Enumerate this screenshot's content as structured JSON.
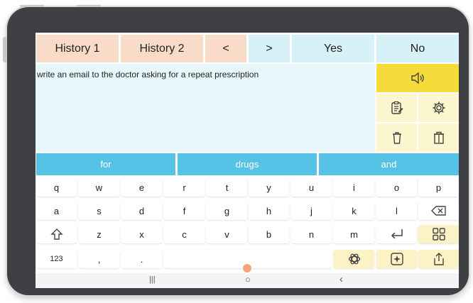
{
  "topbar": {
    "history1": "History 1",
    "history2": "History 2",
    "prev": "<",
    "next": ">",
    "yes": "Yes",
    "no": "No"
  },
  "message": {
    "text": "write an email to the doctor asking for a repeat prescription"
  },
  "suggestions": [
    "for",
    "drugs",
    "and"
  ],
  "keyboard": {
    "row1": [
      "q",
      "w",
      "e",
      "r",
      "t",
      "y",
      "u",
      "i",
      "o",
      "p"
    ],
    "row2": [
      "a",
      "s",
      "d",
      "f",
      "g",
      "h",
      "j",
      "k",
      "l"
    ],
    "row3": [
      "z",
      "x",
      "c",
      "v",
      "b",
      "n",
      "m"
    ],
    "numbers_key": "123",
    "comma_key": ",",
    "period_key": "."
  },
  "icons": {
    "speak": "speaker-icon",
    "notes": "clipboard-icon",
    "settings": "gear-icon",
    "delete_word": "trash-icon",
    "delete_all": "trash-lid-icon",
    "backspace": "backspace-icon",
    "shift": "shift-icon",
    "enter": "enter-icon",
    "grid": "grid-icon",
    "ai": "openai-icon",
    "ai2": "sparkle-icon",
    "share": "share-icon"
  },
  "navbar": {
    "recents": "|||",
    "home": "○",
    "back": "‹"
  },
  "colors": {
    "peach": "#f9dcc7",
    "light_blue": "#d6f1f7",
    "message_bg": "#e8f7fb",
    "yellow": "#f6dc3a",
    "pale_yellow": "#fdf7cf",
    "suggestion_blue": "#55c2e6"
  }
}
